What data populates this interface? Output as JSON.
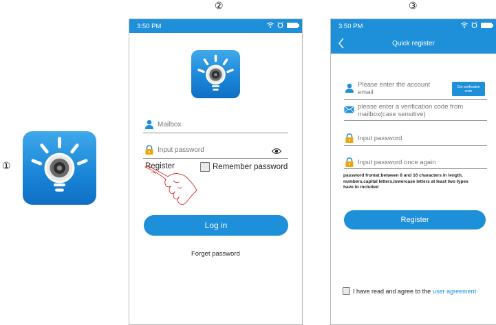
{
  "steps": [
    "①",
    "②",
    "③"
  ],
  "icons": {
    "app": "smart-bulb-camera-icon",
    "account": "person-icon",
    "password": "lock-icon",
    "email": "envelope-icon",
    "show_password": "eye-icon",
    "back": "chevron-left-icon"
  },
  "colors": {
    "accent": "#1e8fd9",
    "icon_gradient_top": "#3fa9ea",
    "icon_gradient_bottom": "#0f6fc4"
  },
  "login_screen": {
    "status_time": "3:50 PM",
    "mailbox_placeholder": "Mailbox",
    "password_placeholder": "Input  password",
    "register_label": "Register",
    "remember_label": "Remember password",
    "login_button": "Log in",
    "forget_label": "Forget password"
  },
  "register_screen": {
    "status_time": "3:50 PM",
    "title": "Quick register",
    "email_placeholder_line1": "Please enter the account",
    "email_placeholder_line2": "email",
    "verify_button_line1": "Get verification",
    "verify_button_line2": "code",
    "code_placeholder_line1": "please enter a verification code from",
    "code_placeholder_line2": "mailbox(case sensitive)",
    "password_placeholder": "Input password",
    "password_again_placeholder": "Input password once again",
    "rules_line1": "password fromat:between 8 and 16 characters in length,",
    "rules_line2": "numbers,capital letters,lowercase letters at least two types",
    "rules_line3": "have to included",
    "register_button": "Register",
    "agree_text": "I have read and agree to the",
    "agree_link": "user agreement"
  }
}
